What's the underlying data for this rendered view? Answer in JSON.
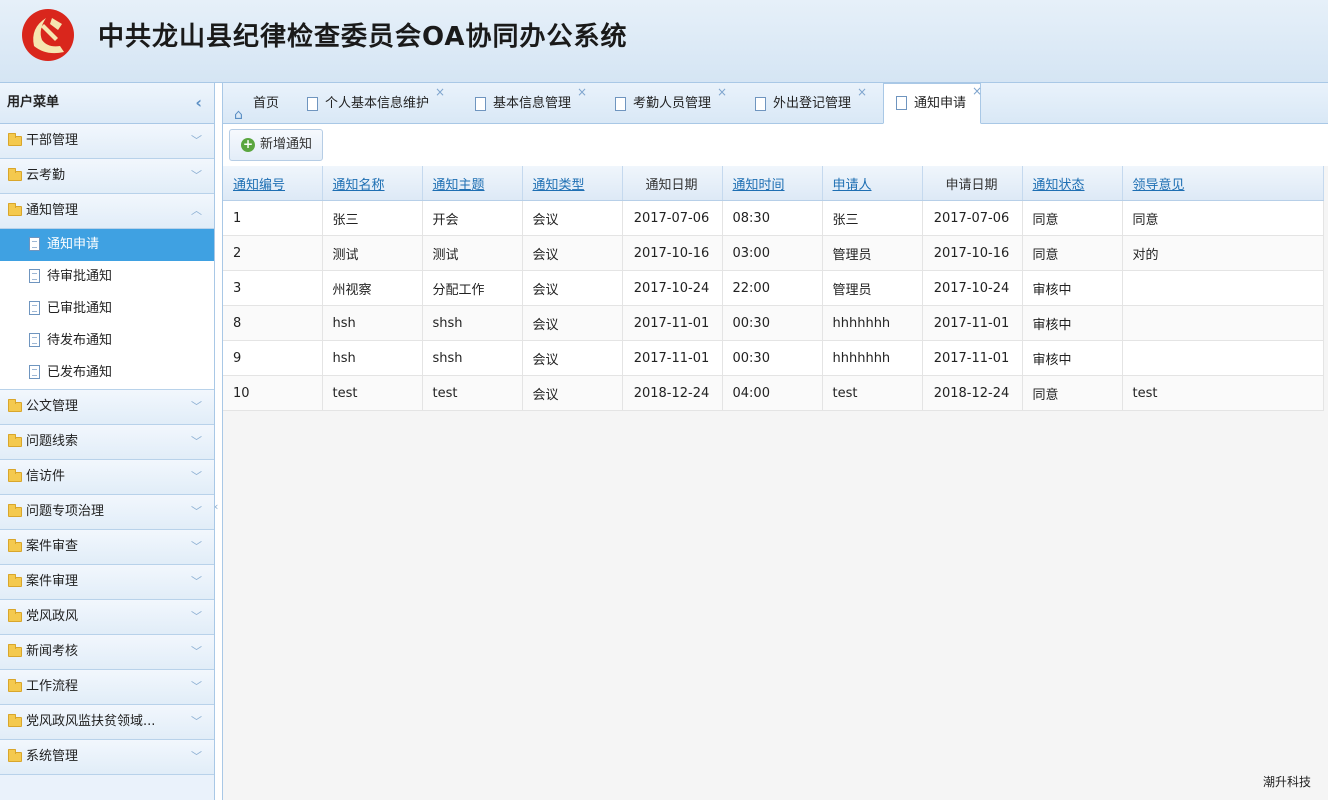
{
  "header": {
    "title": "中共龙山县纪律检查委员会OA协同办公系统"
  },
  "sidebar": {
    "title": "用户菜单",
    "groups_top": [
      {
        "label": "干部管理"
      },
      {
        "label": "云考勤"
      },
      {
        "label": "通知管理"
      }
    ],
    "sub_items": [
      {
        "label": "通知申请"
      },
      {
        "label": "待审批通知"
      },
      {
        "label": "已审批通知"
      },
      {
        "label": "待发布通知"
      },
      {
        "label": "已发布通知"
      }
    ],
    "groups_bottom": [
      {
        "label": "公文管理"
      },
      {
        "label": "问题线索"
      },
      {
        "label": "信访件"
      },
      {
        "label": "问题专项治理"
      },
      {
        "label": "案件审查"
      },
      {
        "label": "案件审理"
      },
      {
        "label": "党风政风"
      },
      {
        "label": "新闻考核"
      },
      {
        "label": "工作流程"
      },
      {
        "label": "党风政风监扶贫领域..."
      },
      {
        "label": "系统管理"
      }
    ]
  },
  "tabs": [
    {
      "label": "首页"
    },
    {
      "label": "个人基本信息维护"
    },
    {
      "label": "基本信息管理"
    },
    {
      "label": "考勤人员管理"
    },
    {
      "label": "外出登记管理"
    },
    {
      "label": "通知申请"
    }
  ],
  "toolbar": {
    "add_label": "新增通知"
  },
  "table": {
    "columns": [
      "通知编号",
      "通知名称",
      "通知主题",
      "通知类型",
      "通知日期",
      "通知时间",
      "申请人",
      "申请日期",
      "通知状态",
      "领导意见"
    ],
    "rows": [
      [
        "1",
        "张三",
        "开会",
        "会议",
        "2017-07-06",
        "08:30",
        "张三",
        "2017-07-06",
        "同意",
        "同意"
      ],
      [
        "2",
        "测试",
        "测试",
        "会议",
        "2017-10-16",
        "03:00",
        "管理员",
        "2017-10-16",
        "同意",
        "对的"
      ],
      [
        "3",
        "州视察",
        "分配工作",
        "会议",
        "2017-10-24",
        "22:00",
        "管理员",
        "2017-10-24",
        "审核中",
        ""
      ],
      [
        "8",
        "hsh",
        "shsh",
        "会议",
        "2017-11-01",
        "00:30",
        "hhhhhhh",
        "2017-11-01",
        "审核中",
        ""
      ],
      [
        "9",
        "hsh",
        "shsh",
        "会议",
        "2017-11-01",
        "00:30",
        "hhhhhhh",
        "2017-11-01",
        "审核中",
        ""
      ],
      [
        "10",
        "test",
        "test",
        "会议",
        "2018-12-24",
        "04:00",
        "test",
        "2018-12-24",
        "同意",
        "test"
      ]
    ]
  },
  "footer": {
    "brand": "潮升科技"
  },
  "colors": {
    "accent": "#3fa1e2",
    "link": "#1e6fb3",
    "header_bg": "#dbe8f5"
  }
}
